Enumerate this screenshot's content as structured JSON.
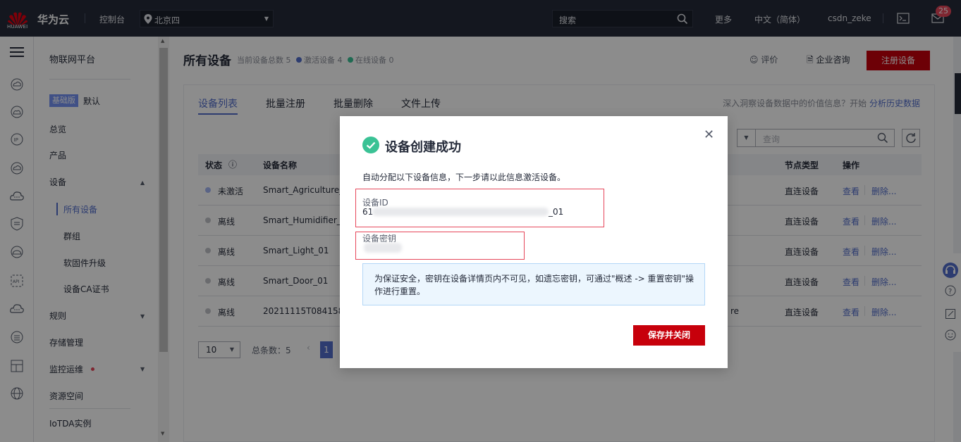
{
  "topbar": {
    "logo_text": "HUAWEI",
    "brand": "华为云",
    "console": "控制台",
    "region": "北京四",
    "search_placeholder": "搜索",
    "more": "更多",
    "language": "中文（简体）",
    "user": "csdn_zeke",
    "notification_count": "25"
  },
  "sidebar": {
    "title": "物联网平台",
    "edition_badge": "基础版",
    "edition_name": "默认",
    "items": [
      {
        "label": "总览"
      },
      {
        "label": "产品"
      },
      {
        "label": "设备"
      },
      {
        "label": "所有设备"
      },
      {
        "label": "群组"
      },
      {
        "label": "软固件升级"
      },
      {
        "label": "设备CA证书"
      },
      {
        "label": "规则"
      },
      {
        "label": "存储管理"
      },
      {
        "label": "监控运维"
      },
      {
        "label": "资源空间"
      },
      {
        "label": "IoTDA实例"
      }
    ]
  },
  "header": {
    "title": "所有设备",
    "stat_total": "当前设备总数 5",
    "stat_active": "激活设备 4",
    "stat_online": "在线设备 0",
    "rate": "评价",
    "consult": "企业咨询",
    "register": "注册设备"
  },
  "tabs": [
    "设备列表",
    "批量注册",
    "批量删除",
    "文件上传"
  ],
  "insight": {
    "text": "深入洞察设备数据中的价值信息？开始",
    "link": "分析历史数据"
  },
  "query_placeholder": "查询",
  "table": {
    "columns": [
      "状态",
      "设备名称",
      "节点类型",
      "操作"
    ],
    "rows": [
      {
        "status": "未激活",
        "name": "Smart_Agriculture_0",
        "extra": "",
        "node": "直连设备",
        "view": "查看",
        "del": "删除..."
      },
      {
        "status": "离线",
        "name": "Smart_Humidifier_01",
        "extra": "",
        "node": "直连设备",
        "view": "查看",
        "del": "删除..."
      },
      {
        "status": "离线",
        "name": "Smart_Light_01",
        "extra": "",
        "node": "直连设备",
        "view": "查看",
        "del": "删除..."
      },
      {
        "status": "离线",
        "name": "Smart_Door_01",
        "extra": "",
        "node": "直连设备",
        "view": "查看",
        "del": "删除..."
      },
      {
        "status": "离线",
        "name": "20211115T084158ZN",
        "extra": "re",
        "node": "直连设备",
        "view": "查看",
        "del": "删除..."
      }
    ]
  },
  "pager": {
    "size": "10",
    "total": "总条数：5",
    "page": "1"
  },
  "colors": {
    "accent": "#526ecc",
    "brand_red": "#c7000b",
    "inactive": "#a4b7f5",
    "offline": "#c2c4c9",
    "success": "#3ac295"
  },
  "modal": {
    "title": "设备创建成功",
    "desc": "自动分配以下设备信息，下一步请以此信息激活设备。",
    "id_label": "设备ID",
    "id_prefix": "61",
    "id_suffix": "_01",
    "secret_label": "设备密钥",
    "notice": "为保证安全，密钥在设备详情页内不可见，如遗忘密钥，可通过\"概述 -> 重置密钥\"操作进行重置。",
    "save": "保存并关闭"
  }
}
